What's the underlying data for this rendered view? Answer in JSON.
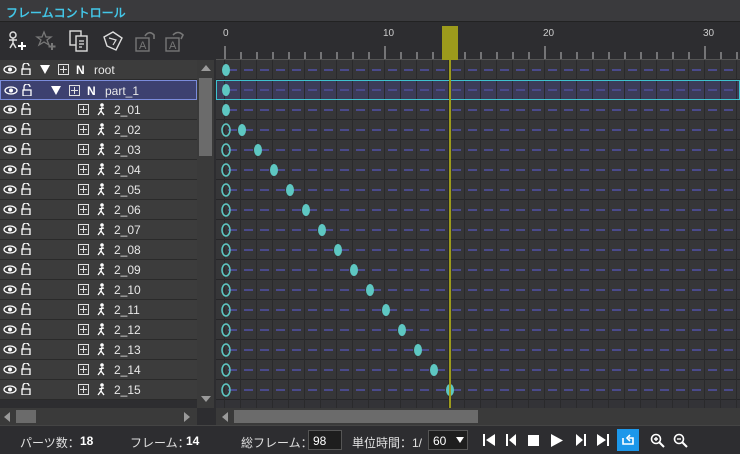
{
  "window": {
    "title": "フレームコントロール"
  },
  "toolbar": {
    "buttons": [
      {
        "name": "add-part-icon"
      },
      {
        "name": "add-effect-icon"
      },
      {
        "name": "copy-icon"
      },
      {
        "name": "paint-icon"
      },
      {
        "name": "undo-icon"
      },
      {
        "name": "redo-icon"
      }
    ]
  },
  "tree": {
    "root": {
      "type_label": "N",
      "label": "root"
    },
    "part": {
      "type_label": "N",
      "label": "part_1"
    },
    "children": [
      "2_01",
      "2_02",
      "2_03",
      "2_04",
      "2_05",
      "2_06",
      "2_07",
      "2_08",
      "2_09",
      "2_10",
      "2_11",
      "2_12",
      "2_13",
      "2_14",
      "2_15"
    ]
  },
  "timeline": {
    "ruler_labels": [
      "0",
      "10",
      "20",
      "30"
    ],
    "current_frame": 14,
    "colors": {
      "key": "#5ec7c2",
      "playhead": "#9c9a1c",
      "row_line": "#4a4a8c"
    }
  },
  "status": {
    "parts_label": "パーツ数：",
    "parts_value": "18",
    "frame_label": "フレーム：",
    "frame_value": "14",
    "total_label": "総フレーム：",
    "total_value": "98",
    "unit_label": "単位時間：1/",
    "unit_value": "60"
  }
}
